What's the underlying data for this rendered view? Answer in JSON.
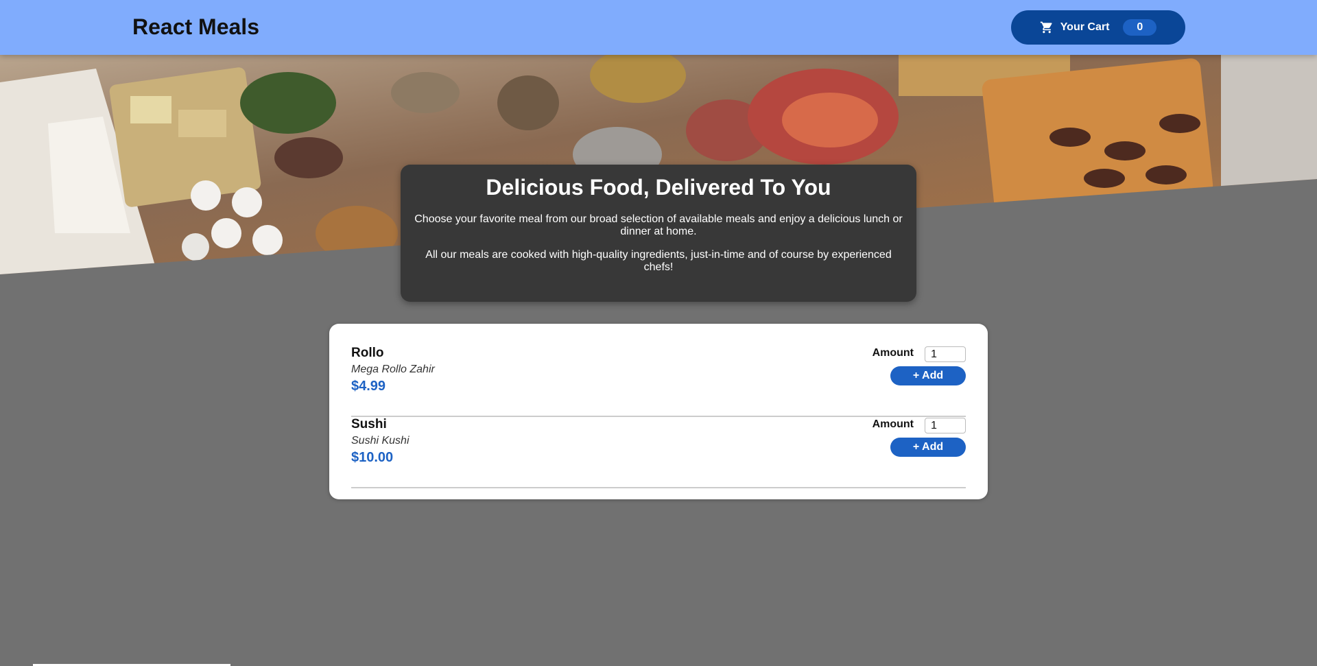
{
  "header": {
    "title": "React Meals",
    "cart_label": "Your Cart",
    "cart_count": "0",
    "cart_icon": "cart-icon"
  },
  "summary": {
    "title": "Delicious Food, Delivered To You",
    "paragraph1": "Choose your favorite meal from our broad selection of available meals and enjoy a delicious lunch or dinner at home.",
    "paragraph2": "All our meals are cooked with high-quality ingredients, just-in-time and of course by experienced chefs!"
  },
  "meals": [
    {
      "name": "Rollo",
      "description": "Mega Rollo Zahir",
      "price": "$4.99",
      "amount_label": "Amount",
      "amount_value": "1",
      "add_label": "+ Add"
    },
    {
      "name": "Sushi",
      "description": "Sushi Kushi",
      "price": "$10.00",
      "amount_label": "Amount",
      "amount_value": "1",
      "add_label": "+ Add"
    }
  ],
  "colors": {
    "header_bg": "#80acfd",
    "cart_button": "#0a4697",
    "accent": "#1d62c4",
    "page_bg": "#717171",
    "summary_bg": "#383838"
  }
}
